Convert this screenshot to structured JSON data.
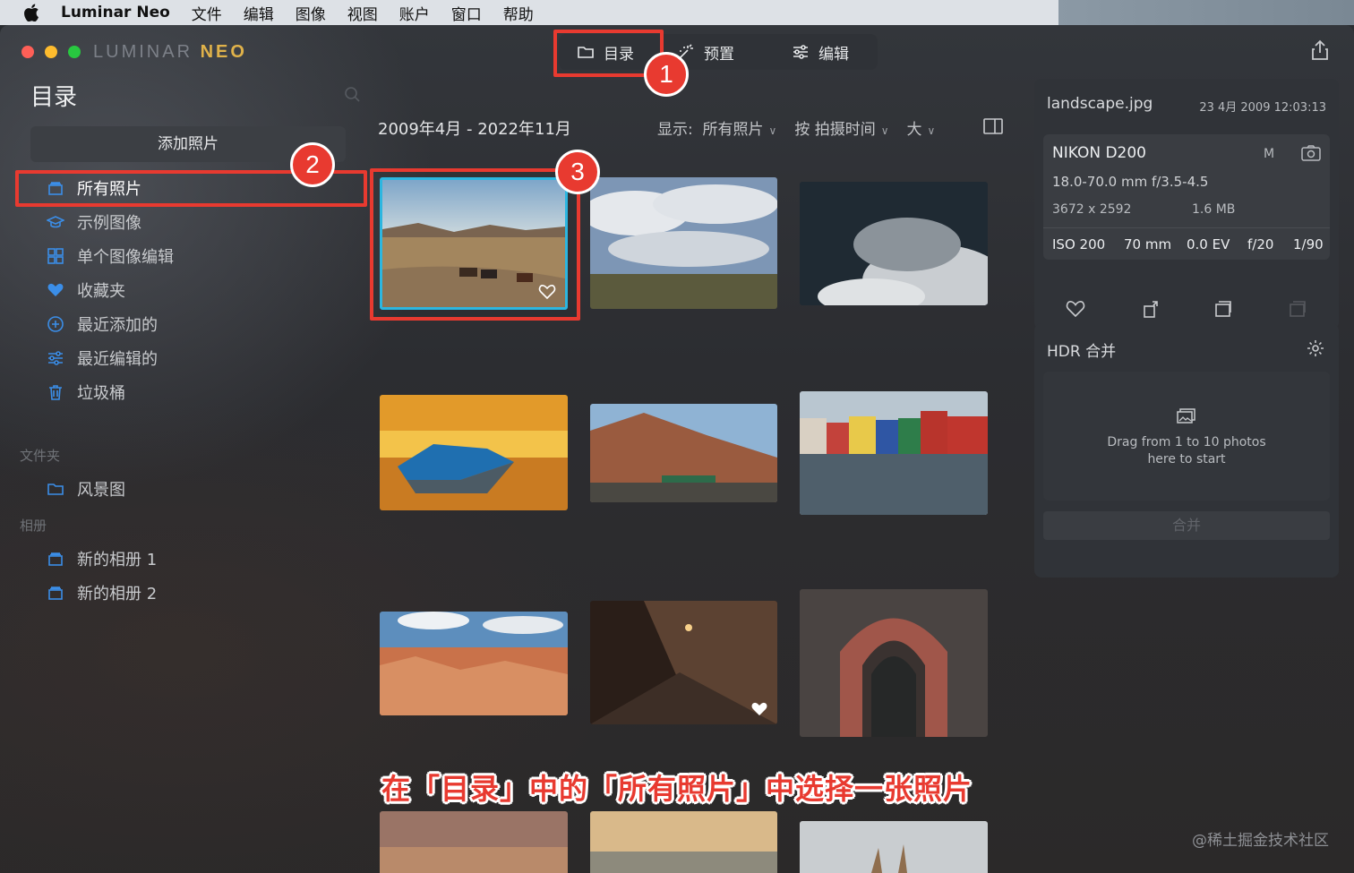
{
  "menubar": {
    "app": "Luminar Neo",
    "items": [
      "文件",
      "编辑",
      "图像",
      "视图",
      "账户",
      "窗口",
      "帮助"
    ]
  },
  "window": {
    "logo_main": "LUMINAR",
    "logo_accent": "NEO"
  },
  "toptabs": [
    {
      "label": "目录",
      "icon": "folder-icon",
      "active": true
    },
    {
      "label": "预置",
      "icon": "sparkle-icon",
      "active": false
    },
    {
      "label": "编辑",
      "icon": "sliders-icon",
      "active": false
    }
  ],
  "sidebar": {
    "title": "目录",
    "add_button": "添加照片",
    "items": [
      {
        "label": "所有照片",
        "icon": "stack-icon",
        "active": true
      },
      {
        "label": "示例图像",
        "icon": "graduation-cap-icon"
      },
      {
        "label": "单个图像编辑",
        "icon": "grid-icon"
      },
      {
        "label": "收藏夹",
        "icon": "heart-icon"
      },
      {
        "label": "最近添加的",
        "icon": "plus-circle-icon"
      },
      {
        "label": "最近编辑的",
        "icon": "sliders-icon"
      },
      {
        "label": "垃圾桶",
        "icon": "trash-icon"
      }
    ],
    "folders_label": "文件夹",
    "folders": [
      {
        "label": "风景图",
        "icon": "folder-icon"
      }
    ],
    "albums_label": "相册",
    "albums": [
      {
        "label": "新的相册 1",
        "icon": "stack-icon"
      },
      {
        "label": "新的相册 2",
        "icon": "stack-icon"
      }
    ]
  },
  "content": {
    "date_range": "2009年4月 - 2022年11月",
    "show_label": "显示:",
    "show_value": "所有照片",
    "sort_value": "按 拍摄时间",
    "size_value": "大"
  },
  "info": {
    "filename": "landscape.jpg",
    "datetime": "23 4月 2009 12:03:13",
    "camera": "NIKON D200",
    "mode": "M",
    "lens": "18.0-70.0 mm f/3.5-4.5",
    "dimensions": "3672 x 2592",
    "filesize": "1.6 MB",
    "iso": "ISO 200",
    "focal": "70 mm",
    "ev": "0.0 EV",
    "aperture": "f/20",
    "shutter": "1/90"
  },
  "hdr": {
    "title": "HDR 合并",
    "drop_text": "Drag from 1 to 10 photos here to start",
    "merge_button": "合并"
  },
  "annotations": {
    "badge1": "1",
    "badge2": "2",
    "badge3": "3",
    "caption": "在「目录」中的「所有照片」中选择一张照片"
  },
  "watermark": "@稀土掘金技术社区",
  "colors": {
    "accent_red": "#e83a30",
    "accent_blue": "#3b8ee8",
    "selection_cyan": "#2cb6e0"
  }
}
